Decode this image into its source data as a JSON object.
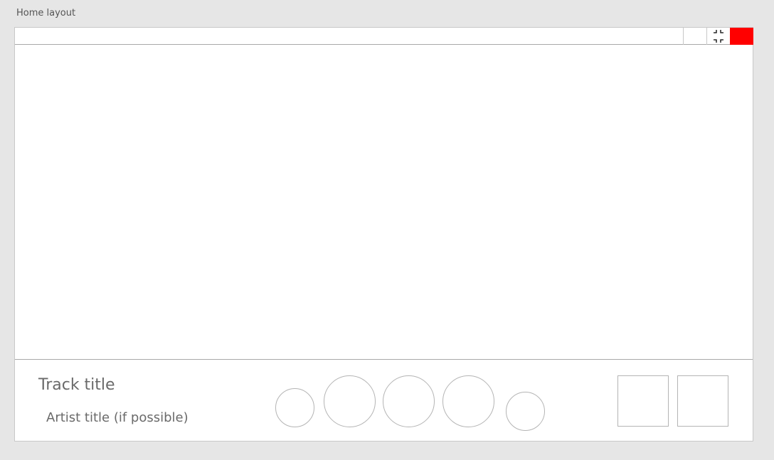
{
  "canvas": {
    "label": "Home layout"
  },
  "window": {
    "controls": {
      "blank_icon": "blank-icon",
      "restore_icon": "restore-icon",
      "close_icon": "close-icon",
      "close_color": "#ff0000"
    }
  },
  "player": {
    "track_title": "Track title",
    "artist_title": "Artist title (if possible)",
    "controls": [
      {
        "icon": "shuffle-icon"
      },
      {
        "icon": "previous-icon"
      },
      {
        "icon": "play-pause-icon"
      },
      {
        "icon": "next-icon"
      },
      {
        "icon": "repeat-icon"
      }
    ],
    "actions": [
      {
        "icon": "queue-icon"
      },
      {
        "icon": "settings-icon"
      }
    ]
  }
}
